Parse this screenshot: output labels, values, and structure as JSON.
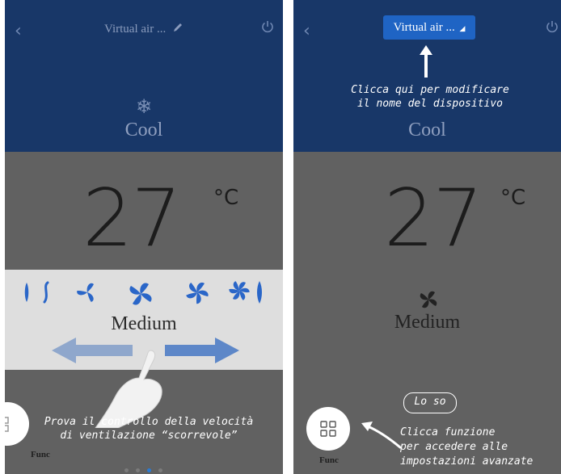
{
  "left_screen": {
    "title": "Virtual air ...",
    "mode": "Cool",
    "temperature": "27",
    "unit": "°C",
    "fan_speed": "Medium",
    "hint": [
      "Prova il controllo della velocità",
      "di ventilazione “scorrevole”"
    ],
    "func_label": "Func",
    "page_dots": {
      "count": 4,
      "active": 3
    }
  },
  "right_screen": {
    "title": "Virtual air ...",
    "mode": "Cool",
    "temperature": "27",
    "unit": "°C",
    "fan_speed": "Medium",
    "rename_hint": [
      "Clicca qui per modificare",
      "il nome del dispositivo"
    ],
    "dismiss_label": "Lo so",
    "func_hint": [
      "Clicca funzione",
      "per accedere alle",
      "impostazioni avanzate"
    ],
    "func_label": "Func"
  },
  "icons": [
    "back-chevron-icon",
    "power-icon",
    "edit-pencil-icon",
    "snowflake-icon",
    "fan-icon",
    "grid-icon",
    "hand-pointer-icon",
    "arrow-left-icon",
    "arrow-right-icon"
  ],
  "colors": {
    "header_blue": "#183768",
    "body_gray": "#616161",
    "fan_panel": "#dedede",
    "title_button": "#1f64c4",
    "active_dot": "#2a7bd4"
  }
}
